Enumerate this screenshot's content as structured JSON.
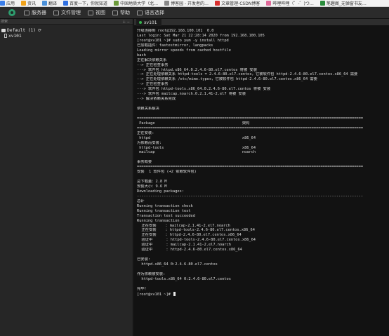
{
  "bookmarks": [
    {
      "label": "应用",
      "color": "#3b7de8"
    },
    {
      "label": "资讯",
      "color": "#f0a21b"
    },
    {
      "label": "翻译",
      "color": "#4a90d9"
    },
    {
      "label": "百度一下，你就知道",
      "color": "#2f6fe0"
    },
    {
      "label": "中国地质大学（北…",
      "color": "#6b9a3a"
    },
    {
      "label": "博客园 - 开发者的…",
      "color": "#888888"
    },
    {
      "label": "文章管理-CSDN博客",
      "color": "#d9302f"
    },
    {
      "label": "哔哩哔哩（゜-゜)つ…",
      "color": "#e06a9a"
    },
    {
      "label": "笔趣阁_无弹窗书友…",
      "color": "#2a8c3c"
    }
  ],
  "menubar": {
    "items": [
      {
        "label": "服务器"
      },
      {
        "label": "文件管理"
      },
      {
        "label": "视图"
      },
      {
        "label": "帮助"
      },
      {
        "label": "语言选择"
      }
    ]
  },
  "sidebar": {
    "header_label": "搜索",
    "tools": "＋ −",
    "group_label": "Default (1)",
    "refresh": "⟳",
    "host": "xv101"
  },
  "tabs": [
    {
      "label": "xv101",
      "close": "×"
    }
  ],
  "terminal": {
    "lines": [
      "升级连接到 root@192.168.100.101  0.0",
      "Last login: Sat Mar 21 22:28:14 2020 from 192.168.100.105",
      "[root@xv101 ~]# sudo yum -y install httpd",
      "已加载插件：fastestmirror, langpacks",
      "Loading mirror speeds from cached hostfile",
      "bash",
      "正在解决依赖关系",
      "--> 正在检查事务",
      "---> 软件包 httpd.x86_64.0.2.4.6-80.el7.centos 将被 安装",
      "--> 正在处理依赖关系 httpd-tools = 2.4.6-80.el7.centos，它被软件包 httpd-2.4.6-80.el7.centos.x86_64 需要",
      "--> 正在处理依赖关系 /etc/mime.types，它被软件包 httpd-2.4.6-80.el7.centos.x86_64 需要",
      "--> 正在检查事务",
      "---> 软件包 httpd-tools.x86_64.0.2.4.6-80.el7.centos 将被 安装",
      "---> 软件包 mailcap.noarch.0.2.1.41-2.el7 将被 安装",
      "--> 解决依赖关系完成",
      "",
      "依赖关系解决",
      "",
      "=====================================================================================================",
      " Package                                       架构",
      "=====================================================================================================",
      "正在安装:",
      " httpd                                         x86_64",
      "为依赖而安装:",
      " httpd-tools                                   x86_64",
      " mailcap                                       noarch",
      "",
      "事务概要",
      "=====================================================================================================",
      "安装  1 软件包 (+2 依赖软件包)",
      "",
      "总下载量：2.8 M",
      "安装大小：9.6 M",
      "Downloading packages:",
      "-----------------------------------------------------------------------------------------------------",
      "总计",
      "Running transaction check",
      "Running transaction test",
      "Transaction test succeeded",
      "Running transaction",
      "  正在安装    : mailcap-2.1.41-2.el7.noarch",
      "  正在安装    : httpd-tools-2.4.6-80.el7.centos.x86_64",
      "  正在安装    : httpd-2.4.6-80.el7.centos.x86_64",
      "  验证中      : httpd-tools-2.4.6-80.el7.centos.x86_64",
      "  验证中      : mailcap-2.1.41-2.el7.noarch",
      "  验证中      : httpd-2.4.6-80.el7.centos.x86_64",
      "",
      "已安装:",
      "  httpd.x86_64 0:2.4.6-80.el7.centos",
      "",
      "作为依赖被安装:",
      "  httpd-tools.x86_64 0:2.4.6-80.el7.centos",
      "",
      "完毕！",
      "[root@xv101 ~]# "
    ]
  },
  "colors": {
    "accent_green": "#37b24d",
    "terminal_bg": "#121212",
    "terminal_fg": "#dcdcdc"
  }
}
